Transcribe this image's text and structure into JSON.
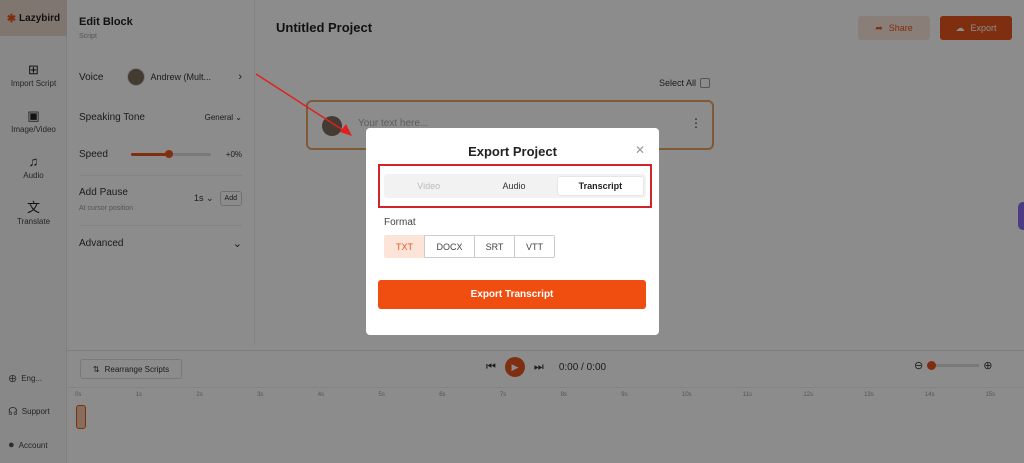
{
  "app": {
    "logo_text": "Lazybird"
  },
  "rail": {
    "items": [
      {
        "label": "Import Script",
        "icon": "file-import-icon"
      },
      {
        "label": "Image/Video",
        "icon": "image-icon"
      },
      {
        "label": "Audio",
        "icon": "music-icon"
      },
      {
        "label": "Translate",
        "icon": "translate-icon"
      }
    ],
    "bottom": [
      {
        "label": "Eng...",
        "icon": "globe-icon"
      },
      {
        "label": "Support",
        "icon": "headset-icon"
      },
      {
        "label": "Account",
        "icon": "user-icon"
      }
    ]
  },
  "panel": {
    "title": "Edit Block",
    "subtitle": "Script",
    "voice_label": "Voice",
    "voice_name": "Andrew (Mult...",
    "tone_label": "Speaking Tone",
    "tone_value": "General",
    "speed_label": "Speed",
    "speed_value": "+0%",
    "speed_fraction": 0.48,
    "pause_label": "Add Pause",
    "pause_sub": "At cursor position",
    "pause_value": "1s",
    "pause_add": "Add",
    "advanced_label": "Advanced"
  },
  "header": {
    "project_title": "Untitled Project",
    "share_label": "Share",
    "export_label": "Export"
  },
  "editor": {
    "select_all": "Select All",
    "placeholder": "Your text here..."
  },
  "timeline": {
    "rearrange_label": "Rearrange Scripts",
    "time": "0:00 / 0:00",
    "ticks": [
      "0s",
      "1s",
      "2s",
      "3s",
      "4s",
      "5s",
      "6s",
      "7s",
      "8s",
      "9s",
      "10s",
      "11s",
      "12s",
      "13s",
      "14s",
      "15s"
    ]
  },
  "modal": {
    "title": "Export Project",
    "tabs": [
      "Video",
      "Audio",
      "Transcript"
    ],
    "active_tab": "Transcript",
    "format_label": "Format",
    "formats": [
      "TXT",
      "DOCX",
      "SRT",
      "VTT"
    ],
    "selected_format": "TXT",
    "export_button": "Export Transcript"
  },
  "colors": {
    "accent": "#e8541e",
    "highlight_box": "#d0242b"
  }
}
